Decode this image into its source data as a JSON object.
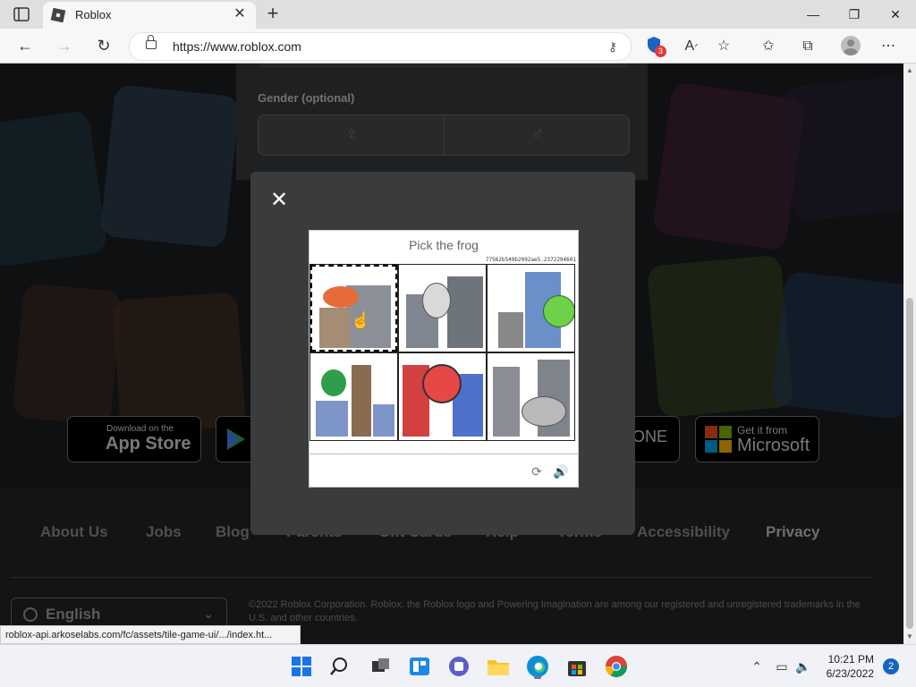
{
  "browser": {
    "tab_title": "Roblox",
    "url": "https://www.roblox.com",
    "shield_badge_count": "3",
    "status_url": "roblox-api.arkoselabs.com/fc/assets/tile-game-ui/.../index.ht..."
  },
  "page": {
    "gender_label": "Gender (optional)",
    "stores": {
      "app_store_small": "Download on the",
      "app_store_big": "App Store",
      "xbox_partial": "ONE",
      "microsoft_small": "Get it from",
      "microsoft_big": "Microsoft"
    },
    "footer_links": [
      "About Us",
      "Jobs",
      "Blog",
      "Parents",
      "Gift Cards",
      "Help",
      "Terms",
      "Accessibility",
      "Privacy"
    ],
    "language": "English",
    "copyright": "©2022 Roblox Corporation. Roblox, the Roblox logo and Powering Imagination are among our registered and unregistered trademarks in the U.S. and other countries."
  },
  "captcha": {
    "prompt": "Pick the frog",
    "session_id": "77562b549b2092ae5.2372294601",
    "tiles": [
      {
        "subject": "crab",
        "selected": true
      },
      {
        "subject": "mouse",
        "selected": false
      },
      {
        "subject": "frog",
        "selected": false
      },
      {
        "subject": "green creature",
        "selected": false
      },
      {
        "subject": "ladybug",
        "selected": false
      },
      {
        "subject": "elephant",
        "selected": false
      }
    ]
  },
  "taskbar": {
    "time": "10:21 PM",
    "date": "6/23/2022",
    "notification_count": "2"
  }
}
